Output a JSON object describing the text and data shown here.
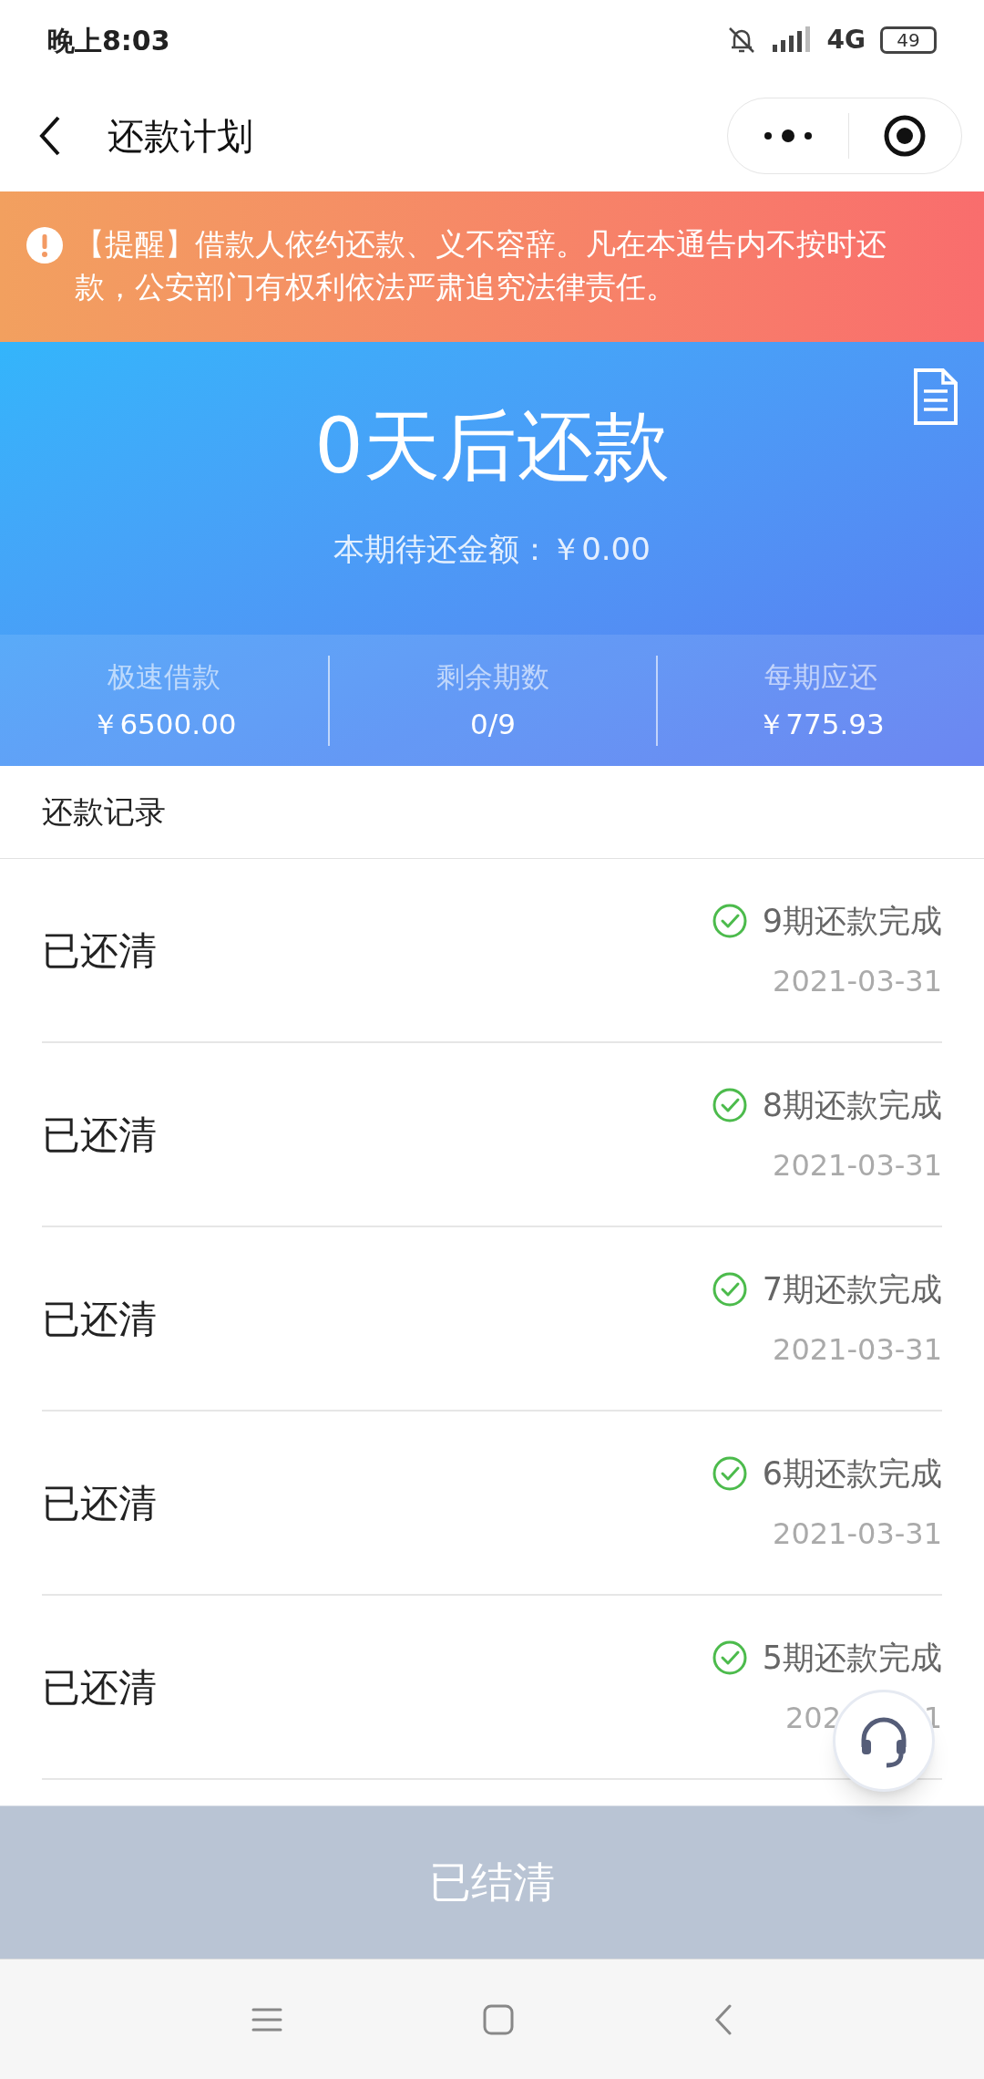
{
  "status_bar": {
    "time": "晚上8:03",
    "network": "4G",
    "battery": "49"
  },
  "header": {
    "title": "还款计划"
  },
  "alert": {
    "text": "【提醒】借款人依约还款、义不容辞。凡在本通告内不按时还款，公安部门有权利依法严肃追究法律责任。"
  },
  "summary": {
    "headline": "0天后还款",
    "due_label": "本期待还金额：",
    "due_amount": "￥0.00",
    "stats": [
      {
        "label": "极速借款",
        "value": "￥6500.00"
      },
      {
        "label": "剩余期数",
        "value": "0/9"
      },
      {
        "label": "每期应还",
        "value": "￥775.93"
      }
    ]
  },
  "records": {
    "title": "还款记录",
    "rows": [
      {
        "status": "已还清",
        "result": "9期还款完成",
        "date": "2021-03-31",
        "done": true
      },
      {
        "status": "已还清",
        "result": "8期还款完成",
        "date": "2021-03-31",
        "done": true
      },
      {
        "status": "已还清",
        "result": "7期还款完成",
        "date": "2021-03-31",
        "done": true
      },
      {
        "status": "已还清",
        "result": "6期还款完成",
        "date": "2021-03-31",
        "done": true
      },
      {
        "status": "已还清",
        "result": "5期还款完成",
        "date": "202",
        "date_tail": "1",
        "done": true
      }
    ]
  },
  "bottom_button": {
    "label": "已结清",
    "disabled": true
  }
}
